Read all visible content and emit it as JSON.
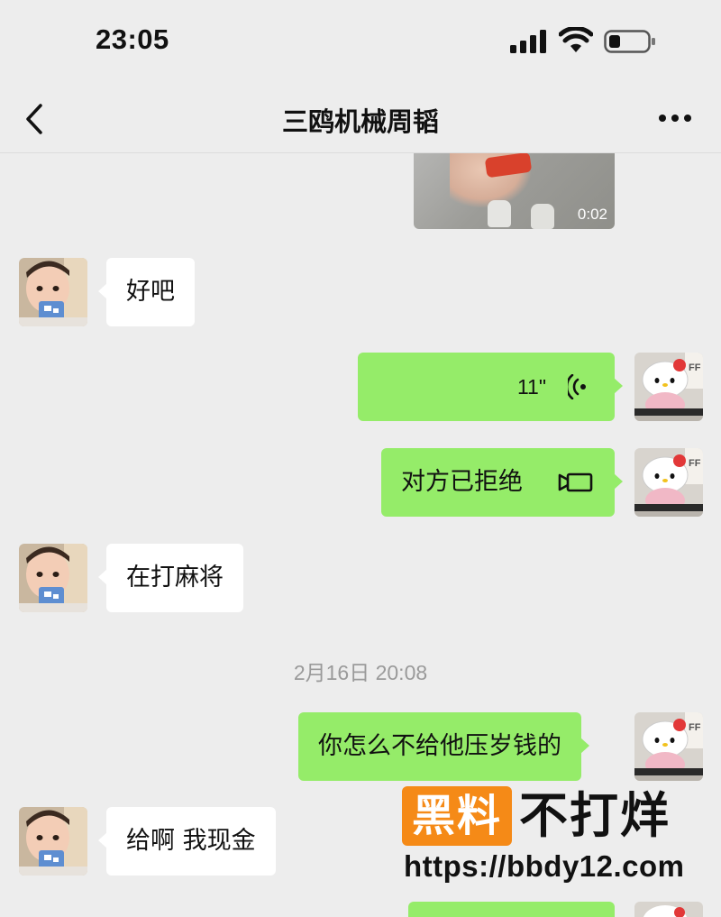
{
  "status_bar": {
    "time": "23:05",
    "signal_icon": "signal-bars-icon",
    "wifi_icon": "wifi-icon",
    "battery_icon": "battery-low-icon"
  },
  "header": {
    "title": "三鸥机械周韬",
    "back_icon": "chevron-left-icon",
    "more_icon": "more-horizontal-icon"
  },
  "messages": [
    {
      "side": "right",
      "type": "video",
      "duration": "0:02"
    },
    {
      "side": "left",
      "type": "text",
      "text": "好吧"
    },
    {
      "side": "right",
      "type": "voice",
      "length": "11\"",
      "icon": "voice-waves-icon"
    },
    {
      "side": "right",
      "type": "video-call",
      "text": "对方已拒绝",
      "icon": "video-call-icon"
    },
    {
      "side": "left",
      "type": "text",
      "text": "在打麻将"
    },
    {
      "type": "timestamp",
      "text": "2月16日 20:08"
    },
    {
      "side": "right",
      "type": "text",
      "text": "你怎么不给他压岁钱的"
    },
    {
      "side": "left",
      "type": "text",
      "text": "给啊 我现金"
    }
  ],
  "watermark": {
    "badge": "黑料",
    "text": "不打烊",
    "url": "https://bbdy12.com"
  },
  "colors": {
    "background": "#ededed",
    "self_bubble": "#95ec69",
    "other_bubble": "#ffffff",
    "watermark_orange": "#f58a17"
  }
}
